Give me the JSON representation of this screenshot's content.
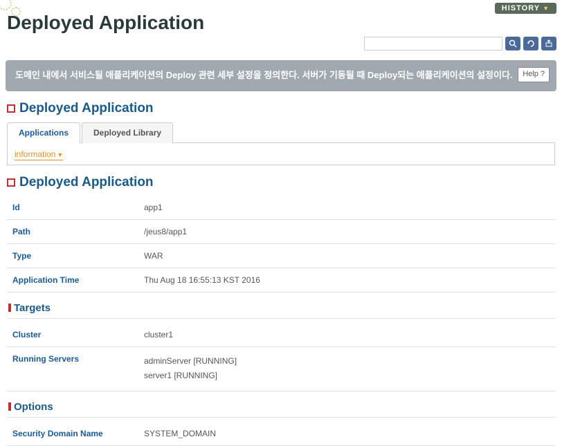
{
  "header": {
    "history_label": "HISTORY",
    "page_title": "Deployed Application",
    "search_placeholder": ""
  },
  "description": {
    "text": "도메인 내에서 서비스될 애플리케이션의 Deploy 관련 세부 설정을 정의한다. 서버가 기동될 때 Deploy되는 애플리케이션의 설정이다.",
    "help_label": "Help ?"
  },
  "section1": {
    "title": "Deployed Application",
    "tabs": [
      {
        "label": "Applications",
        "active": true
      },
      {
        "label": "Deployed Library",
        "active": false
      }
    ],
    "info_link": "information"
  },
  "section2": {
    "title": "Deployed Application",
    "rows": [
      {
        "label": "Id",
        "value": "app1"
      },
      {
        "label": "Path",
        "value": "/jeus8/app1"
      },
      {
        "label": "Type",
        "value": "WAR"
      },
      {
        "label": "Application Time",
        "value": "Thu Aug 18 16:55:13 KST 2016"
      }
    ]
  },
  "targets": {
    "title": "Targets",
    "rows": [
      {
        "label": "Cluster",
        "value": "cluster1"
      },
      {
        "label": "Running Servers",
        "value": "adminServer [RUNNING]\nserver1 [RUNNING]"
      }
    ]
  },
  "options": {
    "title": "Options",
    "rows": [
      {
        "label": "Security Domain Name",
        "value": "SYSTEM_DOMAIN"
      }
    ]
  }
}
